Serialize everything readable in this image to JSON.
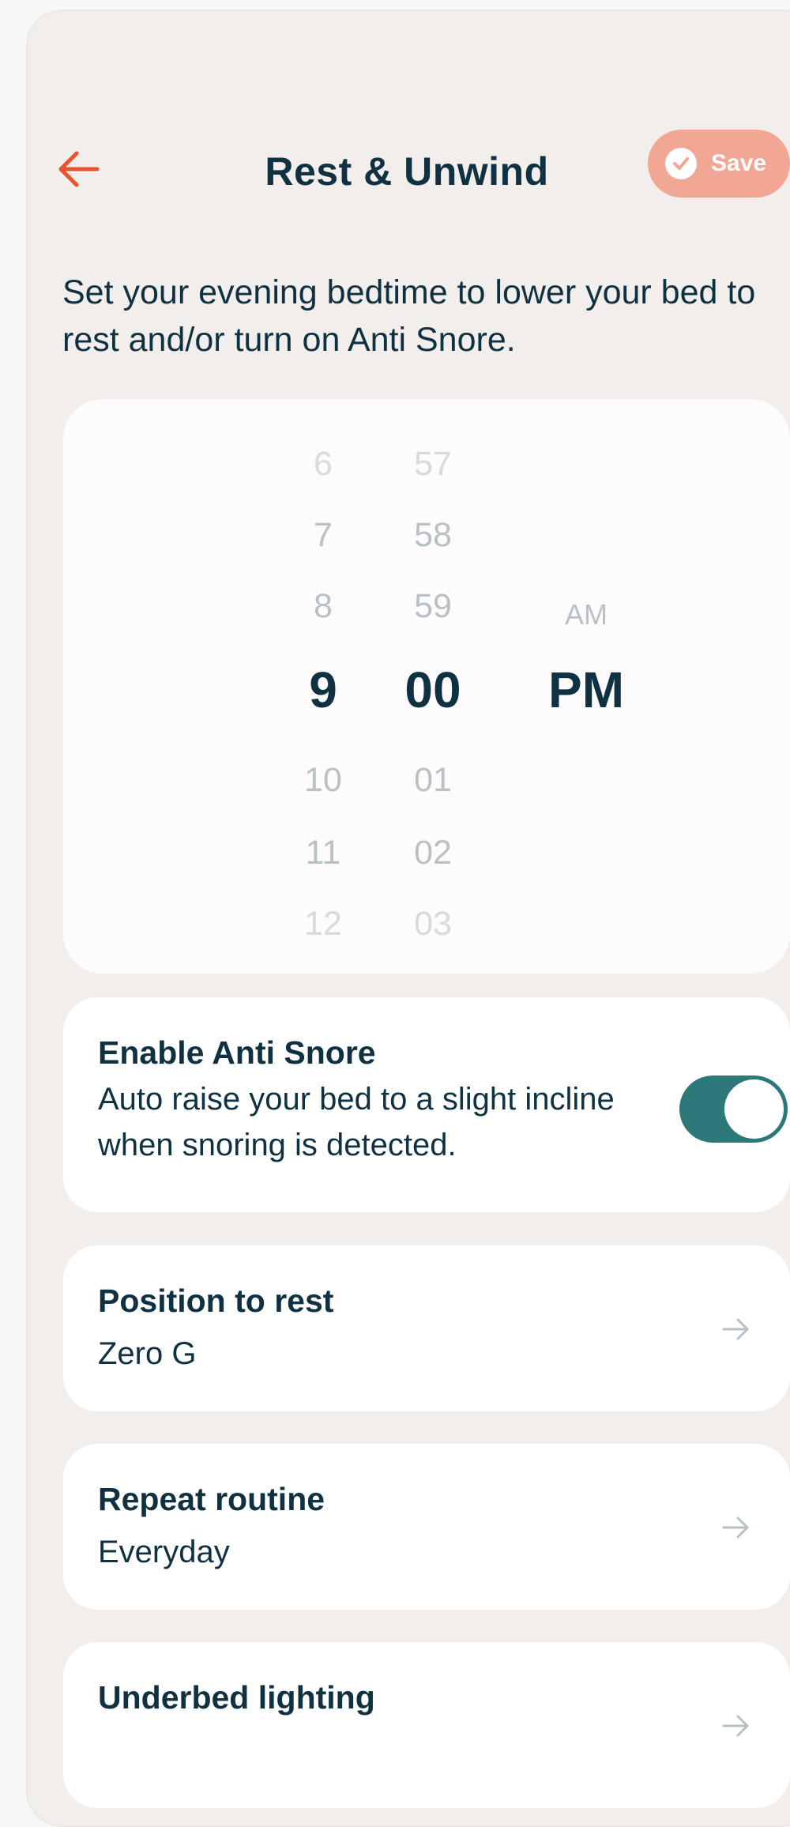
{
  "header": {
    "title": "Rest & Unwind",
    "save_label": "Save"
  },
  "description": "Set your evening bedtime to lower your bed to rest and/or turn on Anti Snore.",
  "picker": {
    "hours": [
      "6",
      "7",
      "8",
      "9",
      "10",
      "11",
      "12"
    ],
    "minutes": [
      "57",
      "58",
      "59",
      "00",
      "01",
      "02",
      "03"
    ],
    "periods": [
      "AM",
      "PM"
    ],
    "selected_hour": "9",
    "selected_minute": "00",
    "selected_period": "PM"
  },
  "anti_snore": {
    "title": "Enable Anti Snore",
    "description": "Auto raise your bed to a slight incline when snoring is detected.",
    "enabled": true
  },
  "position": {
    "title": "Position to rest",
    "value": "Zero G"
  },
  "repeat": {
    "title": "Repeat routine",
    "value": "Everyday"
  },
  "lighting": {
    "title": "Underbed lighting"
  },
  "colors": {
    "accent": "#e8532f",
    "save_button": "#f2a694",
    "toggle_on": "#2d7879",
    "text_dark": "#0f3142",
    "text_faded": "#b8c1c6"
  }
}
